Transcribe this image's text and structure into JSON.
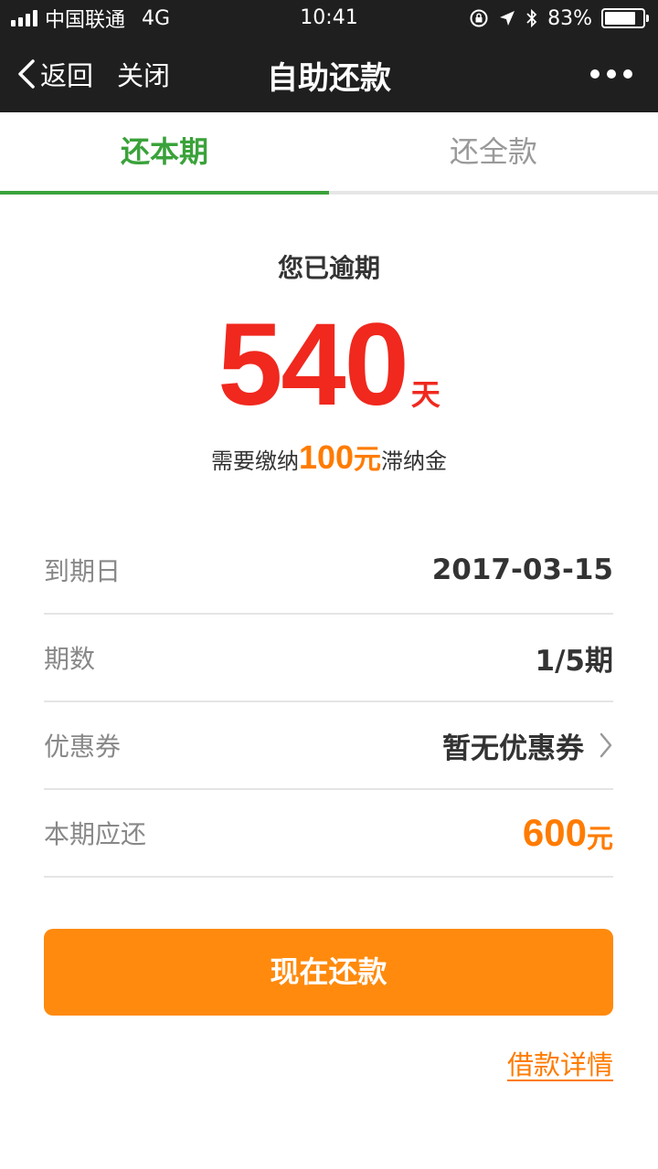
{
  "status_bar": {
    "carrier": "中国联通",
    "network": "4G",
    "time": "10:41",
    "battery": "83%",
    "battery_level": 0.83,
    "icons": [
      "signal-icon",
      "rotation-lock-icon",
      "location-arrow-icon",
      "bluetooth-icon",
      "battery-icon"
    ]
  },
  "navbar": {
    "back_label": "返回",
    "close_label": "关闭",
    "title": "自助还款",
    "more_icon": "more-dots-icon"
  },
  "tabs": [
    {
      "label": "还本期",
      "active": true
    },
    {
      "label": "还全款",
      "active": false
    }
  ],
  "overdue": {
    "label": "您已逾期",
    "days": "540",
    "days_unit": "天",
    "fee_prefix": "需要缴纳",
    "fee_amount": "100",
    "fee_unit": "元",
    "fee_suffix": "滞纳金"
  },
  "details": [
    {
      "label": "到期日",
      "value": "2017-03-15"
    },
    {
      "label": "期数",
      "value": "1/5期"
    },
    {
      "label": "优惠券",
      "value": "暂无优惠券"
    },
    {
      "label": "本期应还",
      "value": "600",
      "unit": "元"
    }
  ],
  "pay_button": {
    "label": "现在还款"
  },
  "loan_details_link": "借款详情",
  "colors": {
    "header_bg": "#1f1f1f",
    "active_tab": "#3aa23a",
    "overdue_red": "#f0281e",
    "accent_orange": "#ff8a0d"
  }
}
